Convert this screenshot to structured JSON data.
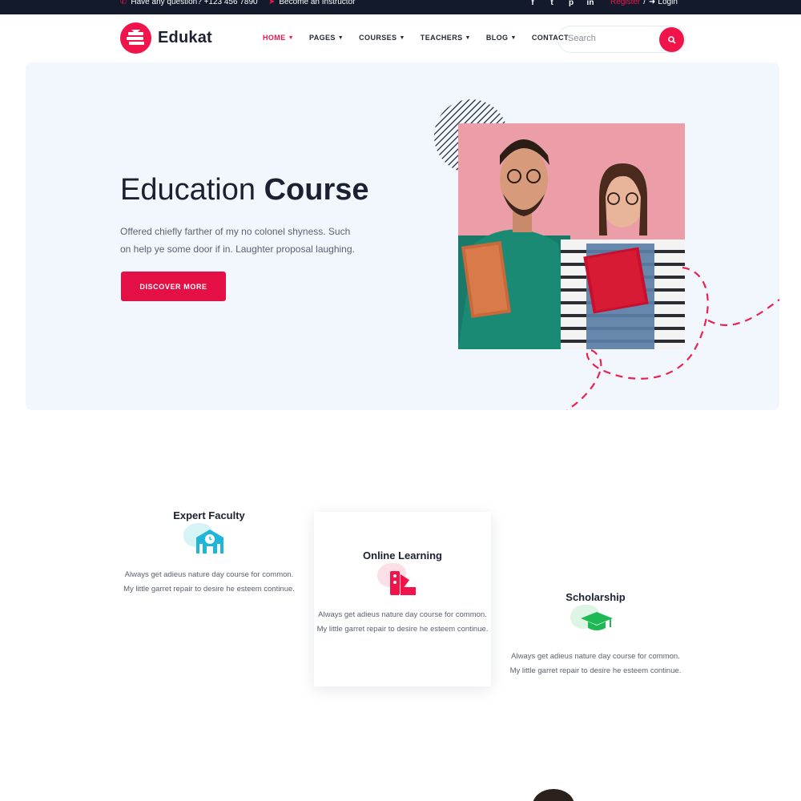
{
  "topbar": {
    "question": "Have any question? +123 456 7890",
    "instructor": "Become an Instructor",
    "social_icons": [
      "facebook-icon",
      "twitter-icon",
      "pinterest-icon",
      "linkedin-icon"
    ],
    "register": "Register",
    "separator": "/",
    "login": "Login"
  },
  "nav": {
    "brand": "Edukat",
    "items": [
      {
        "label": "HOME",
        "active": true,
        "dropdown": true
      },
      {
        "label": "PAGES",
        "active": false,
        "dropdown": true
      },
      {
        "label": "COURSES",
        "active": false,
        "dropdown": true
      },
      {
        "label": "TEACHERS",
        "active": false,
        "dropdown": true
      },
      {
        "label": "BLOG",
        "active": false,
        "dropdown": true
      },
      {
        "label": "CONTACT",
        "active": false,
        "dropdown": false
      }
    ],
    "search_placeholder": "Search"
  },
  "hero": {
    "title_light": "Education",
    "title_bold": "Course",
    "text": "Offered chiefly farther of my no colonel shyness. Such on help ye some door if in. Laughter proposal laughing.",
    "button": "DISCOVER MORE"
  },
  "features": [
    {
      "title": "Expert Faculty",
      "icon": "school-building-icon",
      "text": "Always get adieus nature day course for common. My little garret repair to desire he esteem continue."
    },
    {
      "title": "Online Learning",
      "icon": "color-swatch-icon",
      "text": "Always get adieus nature day course for common. My little garret repair to desire he esteem continue."
    },
    {
      "title": "Scholarship",
      "icon": "graduation-cap-icon",
      "text": "Always get adieus nature day course for common. My little garret repair to desire he esteem continue."
    }
  ],
  "colors": {
    "accent": "#f0144a",
    "topbar": "#121a2b",
    "hero_bg": "#f2f6fd",
    "icon_teal": "#1fb6d9",
    "icon_red": "#f0144a",
    "icon_green": "#1eb854"
  }
}
